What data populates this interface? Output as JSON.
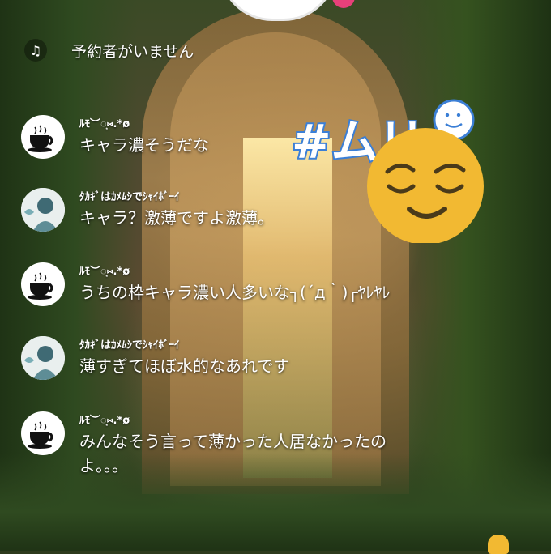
{
  "reservation": {
    "icon": "music-note-icon",
    "text": "予約者がいません"
  },
  "sticker": {
    "hashtag": "#ムリ",
    "emoji": "relieved-face-emoji"
  },
  "messages": [
    {
      "user": "ﾙﾓ︶◌͙⑅.*ø",
      "text": "キャラ濃そうだな",
      "avatar": "tea-cup-avatar"
    },
    {
      "user": "ﾀｶｷﾞはｶﾒﾑｼでｼｬｲﾎﾞｰｲ",
      "text": "キャラ？激薄ですよ激薄。",
      "avatar": "person-illustration-avatar"
    },
    {
      "user": "ﾙﾓ︶◌͙⑅.*ø",
      "text": "うちの枠キャラ濃い人多いな┐(´д｀)┌ﾔﾚﾔﾚ",
      "avatar": "tea-cup-avatar"
    },
    {
      "user": "ﾀｶｷﾞはｶﾒﾑｼでｼｬｲﾎﾞｰｲ",
      "text": "薄すぎてほぼ水的なあれです",
      "avatar": "person-illustration-avatar"
    },
    {
      "user": "ﾙﾓ︶◌͙⑅.*ø",
      "text": "みんなそう言って薄かった人居なかったの\nよ。。。",
      "avatar": "tea-cup-avatar"
    }
  ],
  "colors": {
    "sticker_yellow": "#f2b932",
    "sticker_blue": "#3b7fd6",
    "badge_pink": "#e8407a"
  }
}
